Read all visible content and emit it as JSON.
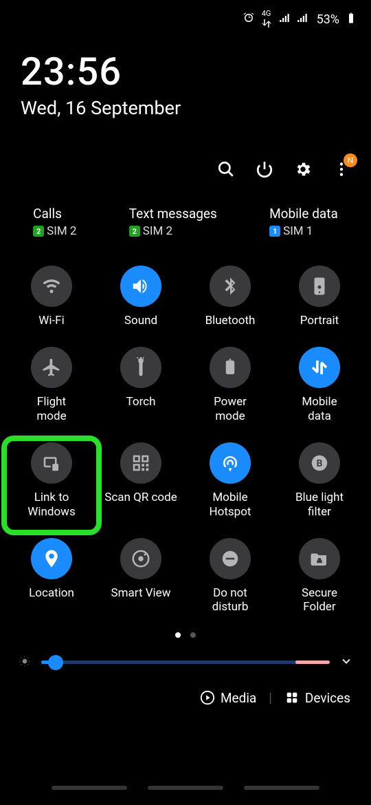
{
  "statusbar": {
    "alarm": true,
    "network_type": "4G",
    "battery_pct": "53%"
  },
  "clock": {
    "time": "23:56",
    "date": "Wed, 16 September"
  },
  "more_badge": "N",
  "sim": {
    "calls": {
      "title": "Calls",
      "num": "2",
      "text": "SIM 2",
      "color": "g"
    },
    "texts": {
      "title": "Text messages",
      "num": "2",
      "text": "SIM 2",
      "color": "g"
    },
    "data": {
      "title": "Mobile data",
      "num": "1",
      "text": "SIM 1",
      "color": "b"
    }
  },
  "tiles": [
    {
      "id": "wifi",
      "label": "Wi-Fi",
      "on": false
    },
    {
      "id": "sound",
      "label": "Sound",
      "on": true
    },
    {
      "id": "bluetooth",
      "label": "Bluetooth",
      "on": false
    },
    {
      "id": "portrait",
      "label": "Portrait",
      "on": false
    },
    {
      "id": "flight",
      "label": "Flight\nmode",
      "on": false
    },
    {
      "id": "torch",
      "label": "Torch",
      "on": false
    },
    {
      "id": "power",
      "label": "Power\nmode",
      "on": false
    },
    {
      "id": "mobiledata",
      "label": "Mobile\ndata",
      "on": true
    },
    {
      "id": "linkwindows",
      "label": "Link to\nWindows",
      "on": false,
      "highlight": true
    },
    {
      "id": "scanqr",
      "label": "Scan QR code",
      "on": false
    },
    {
      "id": "hotspot",
      "label": "Mobile\nHotspot",
      "on": true
    },
    {
      "id": "bluelight",
      "label": "Blue light\nfilter",
      "on": false
    },
    {
      "id": "location",
      "label": "Location",
      "on": true
    },
    {
      "id": "smartview",
      "label": "Smart View",
      "on": false
    },
    {
      "id": "dnd",
      "label": "Do not\ndisturb",
      "on": false
    },
    {
      "id": "securefolder",
      "label": "Secure\nFolder",
      "on": false
    }
  ],
  "pager": {
    "current": 0,
    "total": 2
  },
  "footer": {
    "media": "Media",
    "devices": "Devices"
  },
  "brightness": {
    "value_pct": 5,
    "auto_zone_pct": 12
  }
}
